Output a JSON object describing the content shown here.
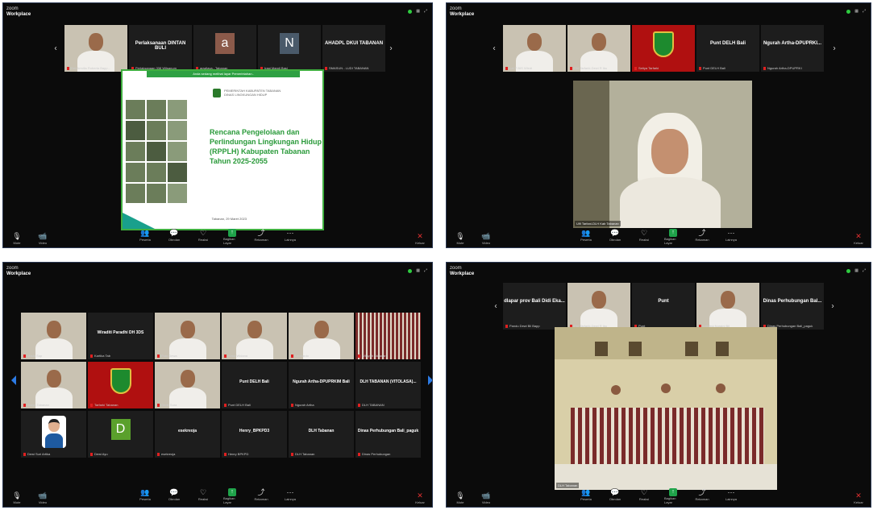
{
  "w1": {
    "title_line1": "zoom",
    "title_line2": "Workplace",
    "strip": [
      {
        "label": "",
        "kind": "face",
        "name": "Dwi Armilia Roberta Bapp..."
      },
      {
        "label": "Perlaksanaan DINTAN BULI",
        "kind": "text",
        "name": "Perlaksanaan 338 Wilsanum"
      },
      {
        "label": "a",
        "kind": "letter",
        "letter_color": "#8b5a4a",
        "name": "apwilaya - Tabanan"
      },
      {
        "label": "N",
        "kind": "letter",
        "letter_color": "#4a5a6a",
        "name": "Iragi Mandi Basi"
      },
      {
        "label": "AHADPL DKUI TABANAN",
        "kind": "text",
        "name": "SMASUN - LUDI TABANAN"
      }
    ],
    "slide": {
      "banner": "Anda sedang melihat layar Pemerintahan..",
      "org_line1": "PEMERINTAH KABUPATEN TABANAN",
      "org_line2": "DINAS LINGKUNGAN HIDUP",
      "title": "Rencana Pengelolaan dan Perlindungan Lingkungan Hidup (RPPLH) Kabupaten Tabanan Tahun 2025-2055",
      "date": "Tabanan, 29 Maret 2023"
    },
    "toolbar": {
      "left": [
        {
          "icon": "🎙",
          "label": "Mute"
        },
        {
          "icon": "📹",
          "label": "Video"
        }
      ],
      "center": [
        {
          "icon": "👥",
          "label": "Peserta"
        },
        {
          "icon": "💬",
          "label": "Obrolan"
        },
        {
          "icon": "♡",
          "label": "Reaksi"
        },
        {
          "icon": "↑",
          "label": "Bagikan Layar"
        },
        {
          "icon": "⤴",
          "label": "Rekaman"
        },
        {
          "icon": "⋯",
          "label": "Lainnya"
        }
      ],
      "right": [
        {
          "icon": "✕",
          "label": "Keluar"
        }
      ]
    }
  },
  "w2": {
    "title_line1": "zoom",
    "title_line2": "Workplace",
    "strip": [
      {
        "label": "",
        "kind": "face",
        "name": "Lat P BIS Wiedi"
      },
      {
        "label": "",
        "kind": "face",
        "name": "Fiki Tarfarki-Dewi R Ibu"
      },
      {
        "label": "",
        "kind": "crest",
        "name": "Setiya Tarfarki"
      },
      {
        "label": "Punt DELH Bali",
        "kind": "text",
        "name": "Punt DELH Bali"
      },
      {
        "label": "Ngurah Artha-DPUPRKI...",
        "kind": "text",
        "name": "Ngurah Artha-DPUPRKI"
      }
    ],
    "speaker_name": "Ulfi Tarfani-DLH Kab Tabanan",
    "toolbar": {
      "left": [
        {
          "icon": "🎙",
          "label": "Mute"
        },
        {
          "icon": "📹",
          "label": "Video"
        }
      ],
      "center": [
        {
          "icon": "👥",
          "label": "Peserta"
        },
        {
          "icon": "💬",
          "label": "Obrolan"
        },
        {
          "icon": "♡",
          "label": "Reaksi"
        },
        {
          "icon": "↑",
          "label": "Bagikan Layar"
        },
        {
          "icon": "⤴",
          "label": "Rekaman"
        },
        {
          "icon": "⋯",
          "label": "Lainnya"
        }
      ],
      "right": [
        {
          "icon": "✕",
          "label": "Keluar"
        }
      ]
    }
  },
  "w3": {
    "title_line1": "zoom",
    "title_line2": "Workplace",
    "grid": [
      {
        "label": "",
        "kind": "face",
        "name": "Made Sup"
      },
      {
        "label": "Wiraditi Paradhi DH 3DS",
        "kind": "text",
        "name": "Kartika Tab"
      },
      {
        "label": "",
        "kind": "face",
        "name": "Putu Dewa"
      },
      {
        "label": "",
        "kind": "face",
        "name": "Ketut Widana"
      },
      {
        "label": "",
        "kind": "face",
        "name": "Leonardo"
      },
      {
        "label": "",
        "kind": "room",
        "name": "Wilayah Tabanan"
      },
      {
        "label": "",
        "kind": "face",
        "name": "Surya Tabanan"
      },
      {
        "label": "",
        "kind": "crest",
        "name": "Tarfarki Tabanan"
      },
      {
        "label": "",
        "kind": "face",
        "name": "Gede Sura"
      },
      {
        "label": "Punt DELH Bali",
        "kind": "text",
        "name": "Punt DELH Bali"
      },
      {
        "label": "Ngurah Artha-DPUPRKIM Bali",
        "kind": "text",
        "name": "Ngurah Artha"
      },
      {
        "label": "DLH TABANAN (VITOLASA)...",
        "kind": "text",
        "name": "DLH TABANAN"
      },
      {
        "label": "",
        "kind": "avatar",
        "name": "Dewi Suri Artika"
      },
      {
        "label": "D",
        "kind": "dletter",
        "name": "Dewi Ayu"
      },
      {
        "label": "esekreoja",
        "kind": "text",
        "name": "esekreoja"
      },
      {
        "label": "Henry_BPKPD3",
        "kind": "text",
        "name": "Henry BPKPD"
      },
      {
        "label": "DLH Tabanan",
        "kind": "text",
        "name": "DLH Tabanan"
      },
      {
        "label": "Dinas Perhubungan Bali_paguk",
        "kind": "text",
        "name": "Dinas Perhubungan"
      }
    ],
    "toolbar": {
      "left": [
        {
          "icon": "🎙",
          "label": "Mute"
        },
        {
          "icon": "📹",
          "label": "Video"
        }
      ],
      "center": [
        {
          "icon": "👥",
          "label": "Peserta"
        },
        {
          "icon": "💬",
          "label": "Obrolan"
        },
        {
          "icon": "♡",
          "label": "Reaksi"
        },
        {
          "icon": "↑",
          "label": "Bagikan Layar"
        },
        {
          "icon": "⤴",
          "label": "Rekaman"
        },
        {
          "icon": "⋯",
          "label": "Lainnya"
        }
      ],
      "right": [
        {
          "icon": "✕",
          "label": "Keluar"
        }
      ]
    }
  },
  "w4": {
    "title_line1": "zoom",
    "title_line2": "Workplace",
    "strip": [
      {
        "label": "dlapar prov Bali Didi Eka...",
        "kind": "text",
        "name": "Pandu Dewi Bli Bapp"
      },
      {
        "label": "",
        "kind": "face",
        "name": "Fiki Tarfarki-Dewi R Ibu"
      },
      {
        "label": "Punt",
        "kind": "text",
        "name": "Punt"
      },
      {
        "label": "",
        "kind": "face",
        "name": "Lidwina Nuraini Bil"
      },
      {
        "label": "Dinas Perhubungan Bal...",
        "kind": "text",
        "name": "Dinas Perhubungan Bali_paguk"
      }
    ],
    "room_name": "DLH Tabanan",
    "toolbar": {
      "left": [
        {
          "icon": "🎙",
          "label": "Mute"
        },
        {
          "icon": "📹",
          "label": "Video"
        }
      ],
      "center": [
        {
          "icon": "👥",
          "label": "Peserta"
        },
        {
          "icon": "💬",
          "label": "Obrolan"
        },
        {
          "icon": "♡",
          "label": "Reaksi"
        },
        {
          "icon": "↑",
          "label": "Bagikan Layar"
        },
        {
          "icon": "⤴",
          "label": "Rekaman"
        },
        {
          "icon": "⋯",
          "label": "Lainnya"
        }
      ],
      "right": [
        {
          "icon": "✕",
          "label": "Keluar"
        }
      ]
    }
  },
  "colors": {
    "window_bg": "#0b0b0b",
    "tile_bg": "#1d1d1d",
    "accent_green": "#1fa34a",
    "mute_red": "#e02020",
    "nav_blue": "#2c7be5"
  }
}
